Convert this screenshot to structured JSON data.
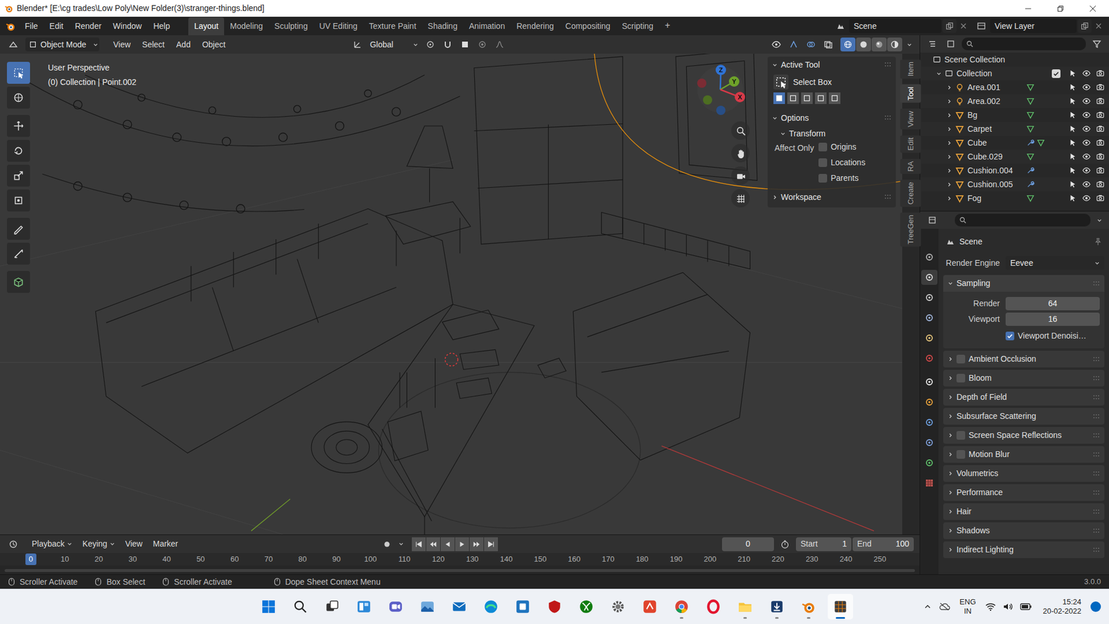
{
  "window": {
    "title": "Blender* [E:\\cg trades\\Low Poly\\New Folder(3)\\stranger-things.blend]"
  },
  "menu": [
    "File",
    "Edit",
    "Render",
    "Window",
    "Help"
  ],
  "workspaces": [
    {
      "label": "Layout",
      "selected": true
    },
    {
      "label": "Modeling",
      "selected": false
    },
    {
      "label": "Sculpting",
      "selected": false
    },
    {
      "label": "UV Editing",
      "selected": false
    },
    {
      "label": "Texture Paint",
      "selected": false
    },
    {
      "label": "Shading",
      "selected": false
    },
    {
      "label": "Animation",
      "selected": false
    },
    {
      "label": "Rendering",
      "selected": false
    },
    {
      "label": "Compositing",
      "selected": false
    },
    {
      "label": "Scripting",
      "selected": false
    }
  ],
  "add_workspace": "+",
  "scene": "Scene",
  "view_layer": "View Layer",
  "viewport_header": {
    "mode": "Object Mode",
    "menu": [
      "View",
      "Select",
      "Add",
      "Object"
    ],
    "orientation": "Global",
    "shading": [
      {
        "selected": true
      },
      {
        "selected": false
      },
      {
        "selected": false
      },
      {
        "selected": false
      }
    ]
  },
  "toolbar": [
    {
      "selected": true
    },
    {
      "selected": false
    },
    {
      "selected": false
    },
    {
      "selected": false
    },
    {
      "selected": false
    },
    {
      "selected": false
    },
    {
      "selected": false
    },
    {
      "selected": false
    },
    {
      "selected": false
    }
  ],
  "viewport": {
    "perspective": "User Perspective",
    "info": "(0) Collection | Point.002"
  },
  "gizmo": {
    "x": "X",
    "y": "Y",
    "z": "Z"
  },
  "sidebar_tabs": [
    {
      "label": "Item",
      "selected": false
    },
    {
      "label": "Tool",
      "selected": true
    },
    {
      "label": "View",
      "selected": false
    },
    {
      "label": "Edit",
      "selected": false
    },
    {
      "label": "RA",
      "selected": false
    },
    {
      "label": "Create",
      "selected": false
    },
    {
      "label": "TreeGen",
      "selected": false
    }
  ],
  "tool_panel": {
    "active_tool": "Active Tool",
    "tool": "Select Box",
    "modes": [
      {
        "selected": true
      },
      {
        "selected": false
      },
      {
        "selected": false
      },
      {
        "selected": false
      },
      {
        "selected": false
      }
    ],
    "options": "Options",
    "transform": "Transform",
    "affect_only": "Affect Only",
    "checkboxes": [
      {
        "label": "Origins",
        "checked": false
      },
      {
        "label": "Locations",
        "checked": false
      },
      {
        "label": "Parents",
        "checked": false
      }
    ],
    "workspace": "Workspace"
  },
  "outliner": {
    "root": "Scene Collection",
    "collection": {
      "label": "Collection",
      "checked": true
    },
    "items": [
      {
        "label": "Area.001",
        "kind": "light",
        "modifier": false,
        "data": true
      },
      {
        "label": "Area.002",
        "kind": "light",
        "modifier": false,
        "data": true
      },
      {
        "label": "Bg",
        "kind": "mesh",
        "modifier": false,
        "data": true
      },
      {
        "label": "Carpet",
        "kind": "mesh",
        "modifier": false,
        "data": true
      },
      {
        "label": "Cube",
        "kind": "mesh",
        "modifier": true,
        "data": true
      },
      {
        "label": "Cube.029",
        "kind": "mesh",
        "modifier": false,
        "data": true
      },
      {
        "label": "Cushion.004",
        "kind": "mesh",
        "modifier": true,
        "data": false
      },
      {
        "label": "Cushion.005",
        "kind": "mesh",
        "modifier": true,
        "data": false
      },
      {
        "label": "Fog",
        "kind": "mesh",
        "modifier": false,
        "data": true
      }
    ]
  },
  "properties": {
    "tabs": [
      {
        "selected": false
      },
      {
        "selected": true
      },
      {
        "selected": false
      },
      {
        "selected": false
      },
      {
        "selected": false
      },
      {
        "selected": false
      },
      {
        "selected": false
      },
      {
        "selected": false
      },
      {
        "selected": false
      },
      {
        "selected": false
      },
      {
        "selected": false
      },
      {
        "selected": false
      }
    ],
    "title": "Scene",
    "render_engine_label": "Render Engine",
    "render_engine": "Eevee",
    "sampling": "Sampling",
    "render_label": "Render",
    "render": "64",
    "viewport_label": "Viewport",
    "viewport": "16",
    "denoise": {
      "label": "Viewport Denoisi…",
      "checked": true
    },
    "panels": [
      {
        "label": "Ambient Occlusion",
        "kind": "toggle",
        "checked": false
      },
      {
        "label": "Bloom",
        "kind": "toggle",
        "checked": false
      },
      {
        "label": "Depth of Field",
        "kind": "plain"
      },
      {
        "label": "Subsurface Scattering",
        "kind": "plain"
      },
      {
        "label": "Screen Space Reflections",
        "kind": "toggle",
        "checked": false
      },
      {
        "label": "Motion Blur",
        "kind": "toggle",
        "checked": false
      },
      {
        "label": "Volumetrics",
        "kind": "plain"
      },
      {
        "label": "Performance",
        "kind": "plain"
      },
      {
        "label": "Hair",
        "kind": "plain"
      },
      {
        "label": "Shadows",
        "kind": "plain"
      },
      {
        "label": "Indirect Lighting",
        "kind": "plain"
      }
    ]
  },
  "timeline": {
    "menu": [
      "Playback",
      "Keying",
      "View",
      "Marker"
    ],
    "frame": "0",
    "start_label": "Start",
    "start": "1",
    "end_label": "End",
    "end": "100",
    "ruler": [
      {
        "label": "0",
        "selected": true
      },
      {
        "label": "10",
        "selected": false
      },
      {
        "label": "20",
        "selected": false
      },
      {
        "label": "30",
        "selected": false
      },
      {
        "label": "40",
        "selected": false
      },
      {
        "label": "50",
        "selected": false
      },
      {
        "label": "60",
        "selected": false
      },
      {
        "label": "70",
        "selected": false
      },
      {
        "label": "80",
        "selected": false
      },
      {
        "label": "90",
        "selected": false
      },
      {
        "label": "100",
        "selected": false
      },
      {
        "label": "110",
        "selected": false
      },
      {
        "label": "120",
        "selected": false
      },
      {
        "label": "130",
        "selected": false
      },
      {
        "label": "140",
        "selected": false
      },
      {
        "label": "150",
        "selected": false
      },
      {
        "label": "160",
        "selected": false
      },
      {
        "label": "170",
        "selected": false
      },
      {
        "label": "180",
        "selected": false
      },
      {
        "label": "190",
        "selected": false
      },
      {
        "label": "200",
        "selected": false
      },
      {
        "label": "210",
        "selected": false
      },
      {
        "label": "220",
        "selected": false
      },
      {
        "label": "230",
        "selected": false
      },
      {
        "label": "240",
        "selected": false
      },
      {
        "label": "250",
        "selected": false
      }
    ]
  },
  "status_bar": {
    "items": [
      "Scroller Activate",
      "Box Select",
      "Scroller Activate",
      "Dope Sheet Context Menu"
    ],
    "version": "3.0.0"
  },
  "taskbar": {
    "apps": [
      {
        "running": false,
        "active": false
      },
      {
        "running": false,
        "active": false
      },
      {
        "running": false,
        "active": false
      },
      {
        "running": false,
        "active": false
      },
      {
        "running": false,
        "active": false
      },
      {
        "running": false,
        "active": false
      },
      {
        "running": false,
        "active": false
      },
      {
        "running": false,
        "active": false
      },
      {
        "running": false,
        "active": false
      },
      {
        "running": false,
        "active": false
      },
      {
        "running": false,
        "active": false
      },
      {
        "running": false,
        "active": false
      },
      {
        "running": false,
        "active": false
      },
      {
        "running": true,
        "active": false
      },
      {
        "running": false,
        "active": false
      },
      {
        "running": true,
        "active": false
      },
      {
        "running": true,
        "active": false
      },
      {
        "running": true,
        "active": false
      },
      {
        "running": true,
        "active": true
      }
    ],
    "lang": "ENG",
    "region": "IN",
    "time": "15:24",
    "date": "20-02-2022"
  }
}
